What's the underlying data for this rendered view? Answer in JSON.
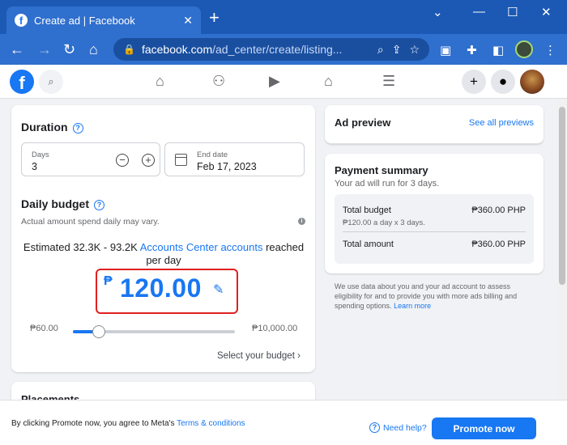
{
  "browser": {
    "tab_title": "Create ad | Facebook",
    "url_host": "facebook.com",
    "url_path": "/ad_center/create/listing...",
    "accent": "#1c59b5"
  },
  "header": {
    "nav_icons": [
      "home-icon",
      "friends-icon",
      "watch-icon",
      "marketplace-icon",
      "menu-icon"
    ]
  },
  "duration": {
    "title": "Duration",
    "days_label": "Days",
    "days_value": "3",
    "end_date_label": "End date",
    "end_date_value": "Feb 17, 2023"
  },
  "budget": {
    "title": "Daily budget",
    "note": "Actual amount spend daily may vary.",
    "estimate_prefix": "Estimated 32.3K - 93.2K ",
    "estimate_link": "Accounts Center accounts",
    "estimate_suffix": " reached per day",
    "currency": "₱",
    "amount": "120.00",
    "min_label": "₱60.00",
    "max_label": "₱10,000.00",
    "slider_fraction": 0.16,
    "select_label": "Select your budget",
    "highlight_color": "#e02020"
  },
  "placements": {
    "title": "Placements"
  },
  "preview": {
    "title": "Ad preview",
    "see_all": "See all previews"
  },
  "summary": {
    "title": "Payment summary",
    "subtitle": "Your ad will run for 3 days.",
    "total_budget_label": "Total budget",
    "total_budget_value": "₱360.00 PHP",
    "breakdown": "₱120.00 a day x 3 days.",
    "total_amount_label": "Total amount",
    "total_amount_value": "₱360.00 PHP"
  },
  "disclaimer": {
    "text": "We use data about you and your ad account to assess eligibility for and to provide you with more ads billing and spending options. ",
    "link": "Learn more"
  },
  "footer": {
    "text": "By clicking Promote now, you agree to Meta's ",
    "link": "Terms & conditions",
    "need_help": "Need help?",
    "promote": "Promote now",
    "brand_color": "#1877f2"
  }
}
